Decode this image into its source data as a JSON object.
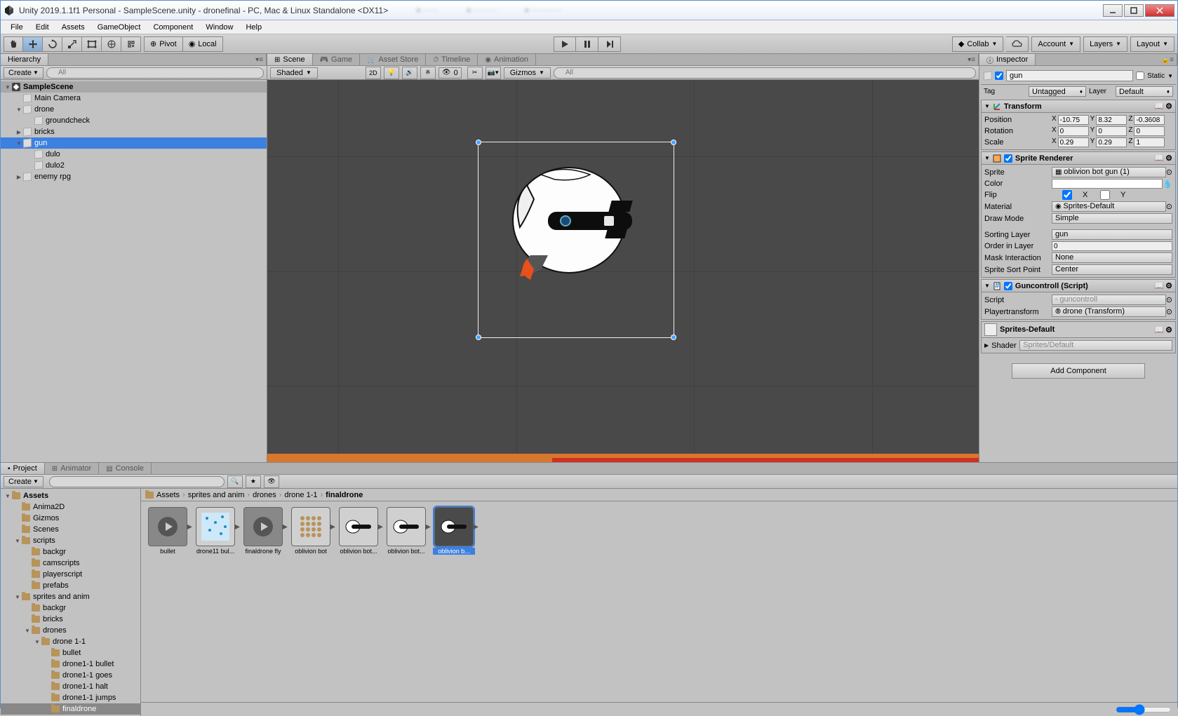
{
  "window": {
    "title": "Unity 2019.1.1f1 Personal - SampleScene.unity - dronefinal - PC, Mac & Linux Standalone <DX11>"
  },
  "menubar": [
    "File",
    "Edit",
    "Assets",
    "GameObject",
    "Component",
    "Window",
    "Help"
  ],
  "toolbar": {
    "pivot": "Pivot",
    "local": "Local",
    "collab": "Collab",
    "account": "Account",
    "layers": "Layers",
    "layout": "Layout"
  },
  "hierarchy": {
    "tab": "Hierarchy",
    "create": "Create",
    "search_placeholder": "All",
    "scene": "SampleScene",
    "items": [
      {
        "label": "Main Camera",
        "depth": 1
      },
      {
        "label": "drone",
        "depth": 1,
        "arrow": "open"
      },
      {
        "label": "groundcheck",
        "depth": 2
      },
      {
        "label": "bricks",
        "depth": 1,
        "arrow": "closed"
      },
      {
        "label": "gun",
        "depth": 1,
        "arrow": "open",
        "selected": true
      },
      {
        "label": "dulo",
        "depth": 2
      },
      {
        "label": "dulo2",
        "depth": 2
      },
      {
        "label": "enemy rpg",
        "depth": 1,
        "arrow": "closed"
      }
    ]
  },
  "sceneview": {
    "tabs": [
      "Scene",
      "Game",
      "Asset Store",
      "Timeline",
      "Animation"
    ],
    "shading": "Shaded",
    "mode_2d": "2D",
    "gizmos": "Gizmos",
    "search_placeholder": "All",
    "audio_count": "0"
  },
  "inspector": {
    "tab": "Inspector",
    "name": "gun",
    "static": "Static",
    "tag_label": "Tag",
    "tag": "Untagged",
    "layer_label": "Layer",
    "layer": "Default",
    "transform": {
      "title": "Transform",
      "position": {
        "x": "-10.75",
        "y": "8.32",
        "z": "-0.3608"
      },
      "rotation": {
        "x": "0",
        "y": "0",
        "z": "0"
      },
      "scale": {
        "x": "0.29",
        "y": "0.29",
        "z": "1"
      },
      "pos_label": "Position",
      "rot_label": "Rotation",
      "scale_label": "Scale"
    },
    "sprite_renderer": {
      "title": "Sprite Renderer",
      "sprite_label": "Sprite",
      "sprite": "oblivion bot gun (1)",
      "color_label": "Color",
      "flip_label": "Flip",
      "flip_x": "X",
      "flip_y": "Y",
      "material_label": "Material",
      "material": "Sprites-Default",
      "draw_mode_label": "Draw Mode",
      "draw_mode": "Simple",
      "sorting_layer_label": "Sorting Layer",
      "sorting_layer": "gun",
      "order_label": "Order in Layer",
      "order": "0",
      "mask_label": "Mask Interaction",
      "mask": "None",
      "sort_point_label": "Sprite Sort Point",
      "sort_point": "Center"
    },
    "guncontroll": {
      "title": "Guncontroll (Script)",
      "script_label": "Script",
      "script": "guncontroll",
      "pt_label": "Playertransform",
      "pt": "drone (Transform)"
    },
    "material": {
      "name": "Sprites-Default",
      "shader_label": "Shader",
      "shader": "Sprites/Default"
    },
    "add_component": "Add Component"
  },
  "project": {
    "tabs": [
      "Project",
      "Animator",
      "Console"
    ],
    "create": "Create",
    "tree": [
      {
        "label": "Assets",
        "depth": 0,
        "arrow": "open",
        "bold": true
      },
      {
        "label": "Anima2D",
        "depth": 1
      },
      {
        "label": "Gizmos",
        "depth": 1
      },
      {
        "label": "Scenes",
        "depth": 1
      },
      {
        "label": "scripts",
        "depth": 1,
        "arrow": "open"
      },
      {
        "label": "backgr",
        "depth": 2
      },
      {
        "label": "camscripts",
        "depth": 2
      },
      {
        "label": "playerscript",
        "depth": 2
      },
      {
        "label": "prefabs",
        "depth": 2
      },
      {
        "label": "sprites and anim",
        "depth": 1,
        "arrow": "open"
      },
      {
        "label": "backgr",
        "depth": 2
      },
      {
        "label": "bricks",
        "depth": 2
      },
      {
        "label": "drones",
        "depth": 2,
        "arrow": "open"
      },
      {
        "label": "drone 1-1",
        "depth": 3,
        "arrow": "open"
      },
      {
        "label": "bullet",
        "depth": 4
      },
      {
        "label": "drone1-1 bullet",
        "depth": 4
      },
      {
        "label": "drone1-1 goes",
        "depth": 4
      },
      {
        "label": "drone1-1 halt",
        "depth": 4
      },
      {
        "label": "drone1-1 jumps",
        "depth": 4
      },
      {
        "label": "finaldrone",
        "depth": 4,
        "selected": true
      }
    ],
    "breadcrumb": [
      "Assets",
      "sprites and anim",
      "drones",
      "drone 1-1",
      "finaldrone"
    ],
    "assets": [
      {
        "label": "bullet",
        "type": "anim"
      },
      {
        "label": "drone11 bul...",
        "type": "sprite-blue"
      },
      {
        "label": "finaldrone fly",
        "type": "anim"
      },
      {
        "label": "oblivion bot",
        "type": "sprite-dots"
      },
      {
        "label": "oblivion bot...",
        "type": "sprite-gun"
      },
      {
        "label": "oblivion bot...",
        "type": "sprite-gun"
      },
      {
        "label": "oblivion b...",
        "type": "sprite-gun",
        "selected": true
      }
    ]
  }
}
